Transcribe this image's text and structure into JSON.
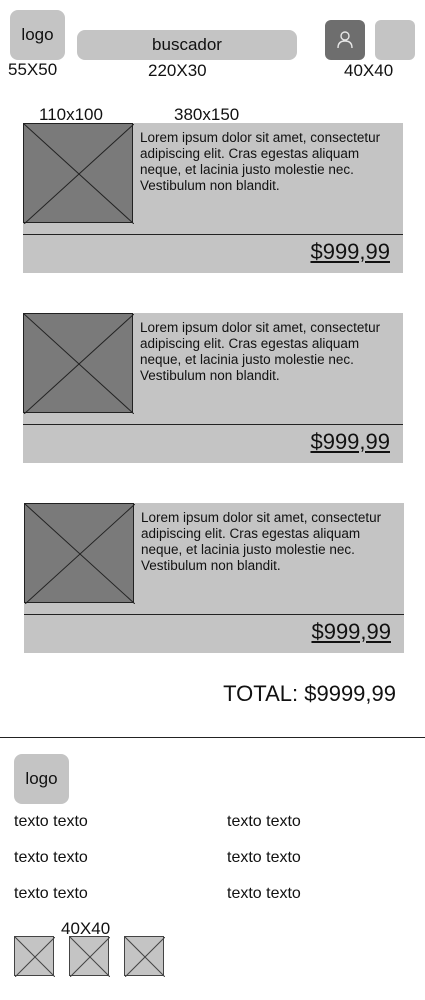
{
  "header": {
    "logo_label": "logo",
    "logo_size": "55X50",
    "search_label": "buscador",
    "search_size": "220X30",
    "icon_size": "40X40",
    "user_icon": "user-icon"
  },
  "product_dims": {
    "thumb": "110x100",
    "card": "380x150"
  },
  "products": [
    {
      "description": "Lorem ipsum dolor sit amet, consectetur adipiscing elit. Cras egestas aliquam neque, et lacinia justo molestie nec. Vestibulum non blandit.",
      "price": "$999,99"
    },
    {
      "description": "Lorem ipsum dolor sit amet, consectetur adipiscing elit. Cras egestas aliquam neque, et lacinia justo molestie nec. Vestibulum non blandit.",
      "price": "$999,99"
    },
    {
      "description": "Lorem ipsum dolor sit amet, consectetur adipiscing elit. Cras egestas aliquam neque, et lacinia justo molestie nec. Vestibulum non blandit.",
      "price": "$999,99"
    }
  ],
  "total": "TOTAL: $9999,99",
  "footer": {
    "logo_label": "logo",
    "links_left": [
      "texto texto",
      "texto texto",
      "texto texto"
    ],
    "links_right": [
      "texto texto",
      "texto texto",
      "texto texto"
    ],
    "social_size": "40X40"
  }
}
